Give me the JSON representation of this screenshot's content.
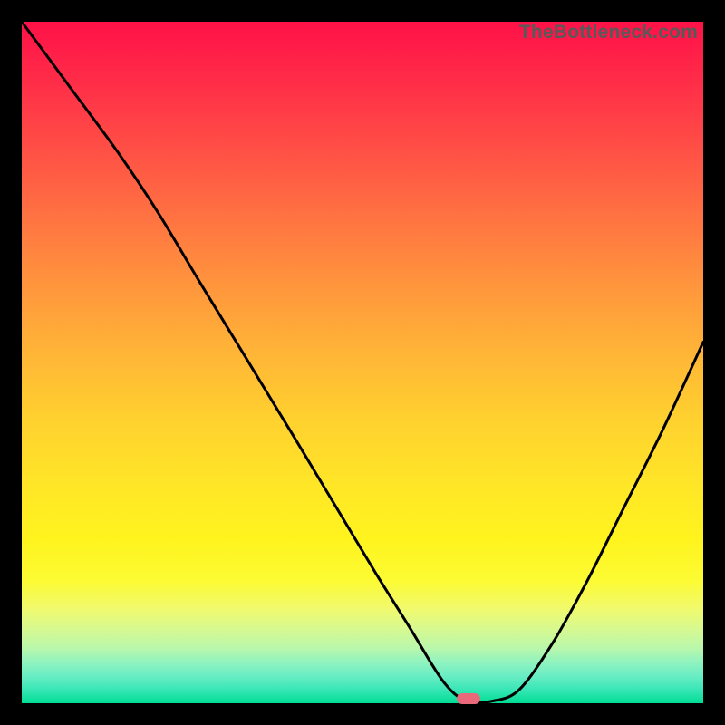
{
  "watermark": "TheBottleneck.com",
  "colors": {
    "frame": "#000000",
    "curve": "#000000",
    "marker": "#e9697a",
    "gradient_top": "#ff1148",
    "gradient_bottom": "#00dd94"
  },
  "chart_data": {
    "type": "line",
    "title": "",
    "xlabel": "",
    "ylabel": "",
    "xlim": [
      0,
      1
    ],
    "ylim": [
      0,
      1
    ],
    "note": "Axes are unlabeled in the image; coordinates are normalized to the plot area (0=left/bottom, 1=right/top). Values estimated from pixel positions.",
    "series": [
      {
        "name": "curve",
        "x": [
          0.0,
          0.07,
          0.14,
          0.2,
          0.26,
          0.33,
          0.4,
          0.46,
          0.52,
          0.57,
          0.6,
          0.62,
          0.64,
          0.66,
          0.69,
          0.73,
          0.78,
          0.83,
          0.88,
          0.94,
          1.0
        ],
        "y": [
          1.0,
          0.905,
          0.81,
          0.72,
          0.62,
          0.505,
          0.39,
          0.29,
          0.19,
          0.11,
          0.06,
          0.03,
          0.01,
          0.003,
          0.003,
          0.02,
          0.09,
          0.18,
          0.28,
          0.4,
          0.53
        ]
      }
    ],
    "marker": {
      "x": 0.655,
      "y": 0.006
    },
    "flat_minimum_range_x": [
      0.63,
      0.69
    ]
  }
}
